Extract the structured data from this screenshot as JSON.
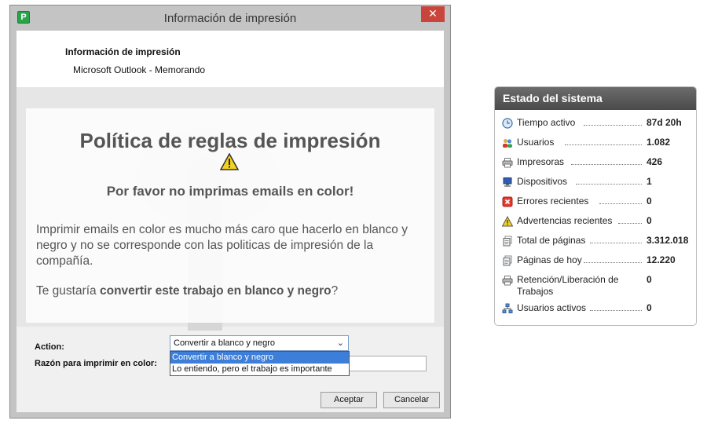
{
  "dialog": {
    "window_title": "Información de impresión",
    "app_icon_letter": "P",
    "close_label": "✕",
    "header_title": "Información de impresión",
    "header_subtitle": "Microsoft Outlook - Memorando",
    "policy_title": "Política de reglas de impresión",
    "policy_subtitle": "Por favor no imprimas emails en color!",
    "policy_text": "Imprimir emails en color es mucho más caro que hacerlo en blanco y negro y no se corresponde con las politicas de impresión de la compañía.",
    "question_prefix": "Te gustaría ",
    "question_bold": "convertir este trabajo en blanco y negro",
    "question_suffix": "?",
    "action_label": "Action:",
    "action_selected": "Convertir a blanco y negro",
    "action_options": [
      "Convertir a blanco y negro",
      "Lo entiendo, pero el trabajo es importante"
    ],
    "reason_label": "Razón para imprimir en color:",
    "reason_value": "",
    "ok_label": "Aceptar",
    "cancel_label": "Cancelar"
  },
  "status": {
    "title": "Estado del sistema",
    "items": [
      {
        "label": "Tiempo activo",
        "value": "87d 20h",
        "icon": "clock-icon"
      },
      {
        "label": "Usuarios",
        "value": "1.082",
        "icon": "users-icon"
      },
      {
        "label": "Impresoras",
        "value": "426",
        "icon": "printer-icon"
      },
      {
        "label": "Dispositivos",
        "value": "1",
        "icon": "device-icon"
      },
      {
        "label": "Errores recientes",
        "value": "0",
        "icon": "error-icon"
      },
      {
        "label": "Advertencias recientes",
        "value": "0",
        "icon": "warning-icon"
      },
      {
        "label": "Total de páginas",
        "value": "3.312.018",
        "icon": "pages-icon"
      },
      {
        "label": "Páginas de hoy",
        "value": "12.220",
        "icon": "pages-today-icon"
      },
      {
        "label": "Retención/Liberación de Trabajos",
        "value": "0",
        "icon": "hold-release-icon"
      },
      {
        "label": "Usuarios activos",
        "value": "0",
        "icon": "active-users-icon"
      }
    ]
  }
}
